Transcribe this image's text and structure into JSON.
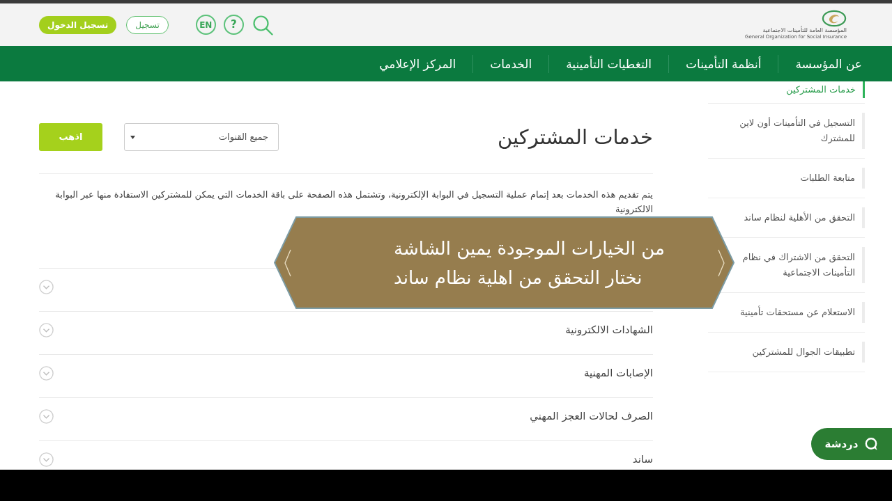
{
  "header": {
    "logo": {
      "name_ar": "المؤسسة العامة للتأمينات الاجتماعية",
      "name_en": "General Organization for Social Insurance"
    },
    "login_button": "تسجيل الدخول",
    "register_button": "تسجيل",
    "language_button": "EN",
    "help_button": "?"
  },
  "nav": {
    "items": [
      {
        "label": "عن المؤسسة"
      },
      {
        "label": "أنظمة التأمينات"
      },
      {
        "label": "التغطيات التأمينية"
      },
      {
        "label": "الخدمات"
      },
      {
        "label": "المركز الإعلامي"
      }
    ]
  },
  "sidebar": {
    "items": [
      {
        "label": "خدمات المشتركين",
        "selected": true
      },
      {
        "label": "التسجيل في التأمينات أون لاين للمشترك",
        "selected": false
      },
      {
        "label": "متابعة الطلبات",
        "selected": false
      },
      {
        "label": "التحقق من الأهلية لنظام ساند",
        "selected": false
      },
      {
        "label": "التحقق من الاشتراك في نظام التأمينات الاجتماعية",
        "selected": false
      },
      {
        "label": "الاستعلام عن مستحقات تأمينية",
        "selected": false
      },
      {
        "label": "تطبيقات الجوال للمشتركين",
        "selected": false
      }
    ]
  },
  "content": {
    "title": "خدمات المشتركين",
    "channel_select": {
      "value": "جميع القنوات"
    },
    "go_button": "اذهب",
    "intro": "يتم تقديم هذه الخدمات بعد إتمام عملية التسجيل في البوابة الإلكترونية، وتشتمل هذه الصفحة على باقة الخدمات التي يمكن للمشتركين الاستفادة منها عبر البوابة الالكترونية",
    "accordion": [
      {
        "expanded": false
      },
      {
        "label": "الشهادات الالكترونية",
        "expanded": false
      },
      {
        "label": "الإصابات المهنية",
        "expanded": false
      },
      {
        "label": "الصرف لحالات العجز المهني",
        "expanded": false
      },
      {
        "label": "ساند",
        "expanded": false
      }
    ]
  },
  "caption": {
    "lines": [
      "من الخيارات الموجودة يمين الشاشة",
      "نختار التحقق من اهلية نظام ساند"
    ]
  },
  "chat_button": "دردشة"
}
